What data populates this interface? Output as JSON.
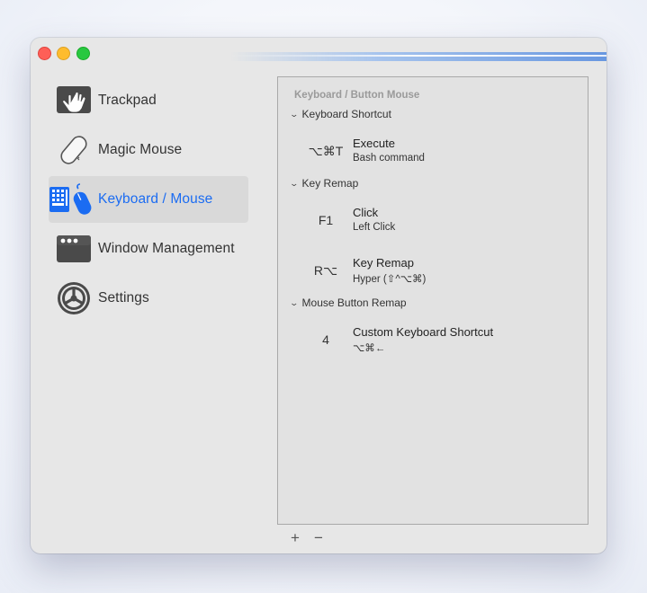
{
  "window": {
    "controls": [
      "close",
      "minimize",
      "zoom"
    ]
  },
  "sidebar": {
    "items": [
      {
        "label": "Trackpad",
        "icon": "trackpad-icon",
        "selected": false
      },
      {
        "label": "Magic Mouse",
        "icon": "magic-mouse-icon",
        "selected": false
      },
      {
        "label": "Keyboard / Mouse",
        "icon": "keyboard-mouse-icon",
        "selected": true
      },
      {
        "label": "Window Management",
        "icon": "window-management-icon",
        "selected": false
      },
      {
        "label": "Settings",
        "icon": "settings-gear-icon",
        "selected": false
      }
    ]
  },
  "panel": {
    "header": "Keyboard / Button Mouse",
    "groups": [
      {
        "title": "Keyboard Shortcut",
        "rows": [
          {
            "key": "⌥⌘T",
            "title": "Execute",
            "subtitle": "Bash command"
          }
        ]
      },
      {
        "title": "Key Remap",
        "rows": [
          {
            "key": "F1",
            "title": "Click",
            "subtitle": "Left Click"
          },
          {
            "key": "R⌥",
            "title": "Key Remap",
            "subtitle": "Hyper (⇧^⌥⌘)"
          }
        ]
      },
      {
        "title": "Mouse Button Remap",
        "rows": [
          {
            "key": "4",
            "title": "Custom Keyboard Shortcut",
            "subtitle": "⌥⌘←"
          }
        ]
      }
    ]
  },
  "footer": {
    "add_label": "+",
    "remove_label": "−"
  },
  "colors": {
    "accent": "#1b6cf2",
    "window_bg": "#e7e7e7",
    "selected_bg": "#d9d9d9"
  }
}
